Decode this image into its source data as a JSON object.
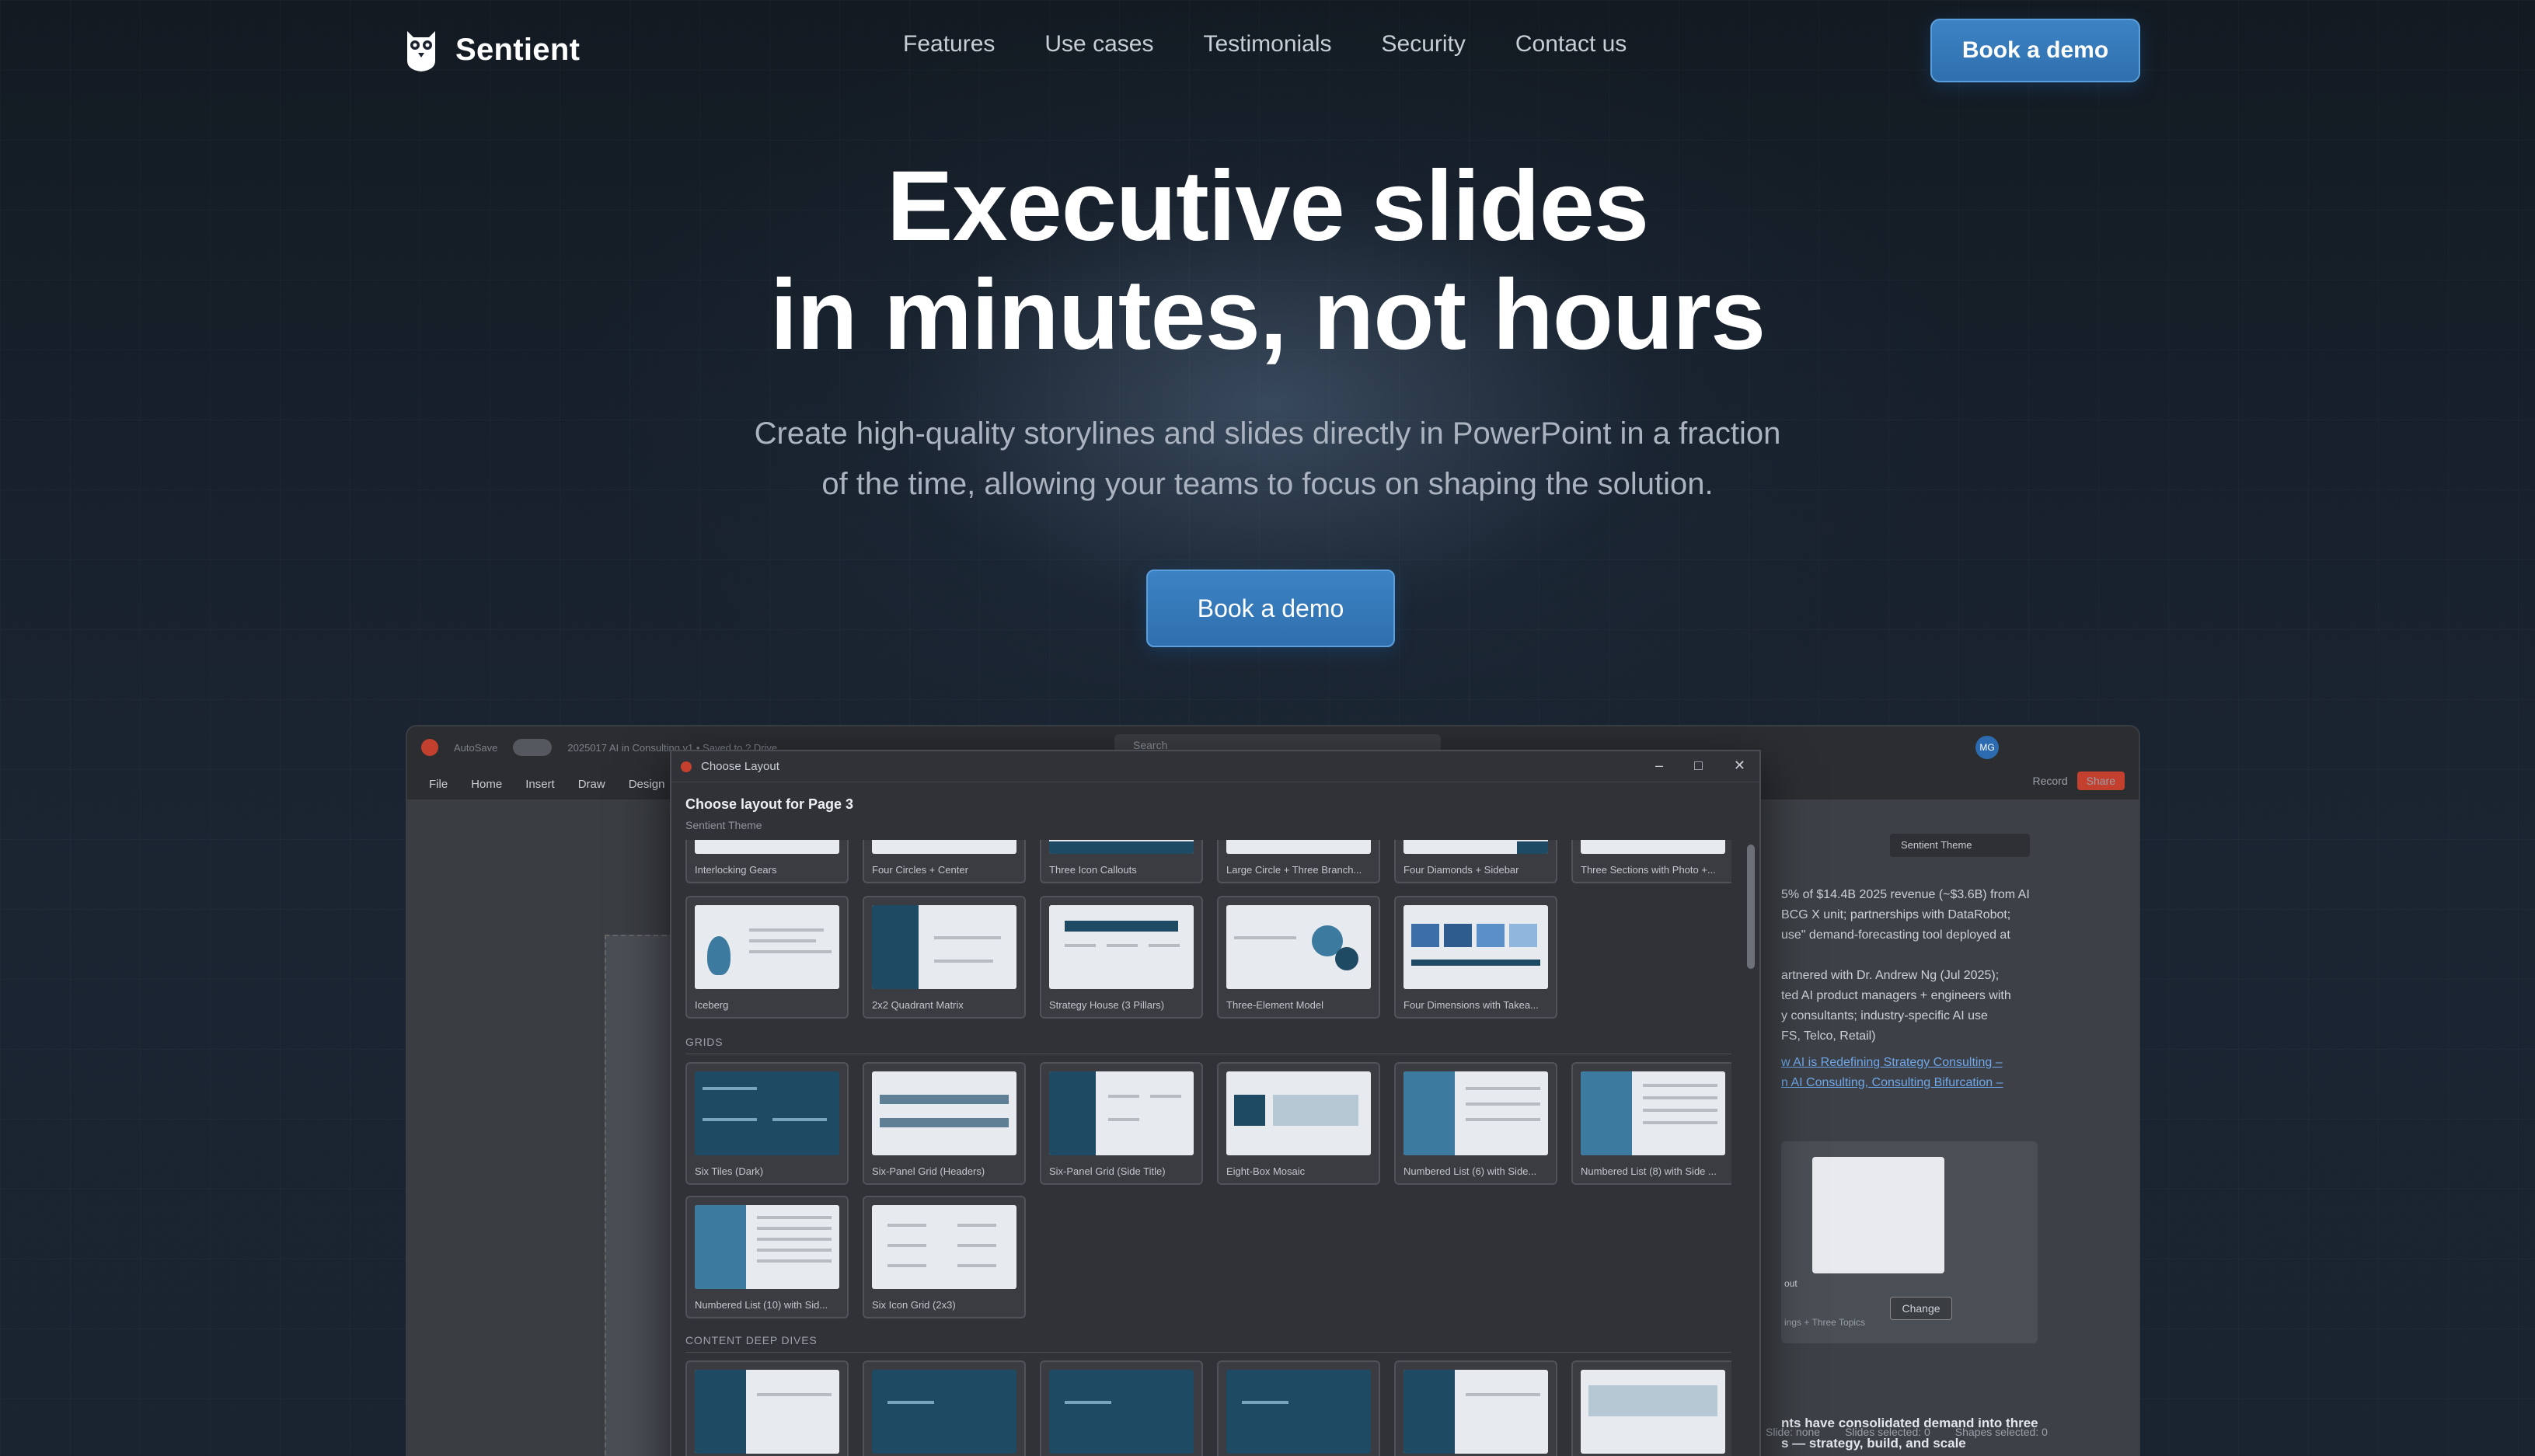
{
  "nav": {
    "brand": "Sentient",
    "links": [
      "Features",
      "Use cases",
      "Testimonials",
      "Security",
      "Contact us"
    ],
    "cta": "Book a demo"
  },
  "hero": {
    "title_line1": "Executive slides",
    "title_line2": "in minutes, not hours",
    "sub_line1": "Create high-quality storylines and slides directly in PowerPoint in a fraction",
    "sub_line2": "of the time, allowing your teams to focus on shaping the solution.",
    "cta": "Book a demo"
  },
  "app": {
    "autosave": "AutoSave",
    "autosave_state": "Off",
    "doc_title": "2025017 AI in Consulting v1 • Saved to ? Drive",
    "search_placeholder": "Search",
    "user_initials": "MG",
    "menu": [
      "File",
      "Home",
      "Insert",
      "Draw",
      "Design"
    ],
    "record": "Record",
    "share": "Share",
    "side": {
      "theme": "Sentient Theme",
      "text_1": "5% of $14.4B 2025 revenue (~$3.6B) from AI",
      "text_2": "BCG X unit; partnerships with DataRobot;",
      "text_3": "use\" demand-forecasting tool deployed at",
      "text_4": "artnered with Dr. Andrew Ng (Jul 2025);",
      "text_5": "ted AI product managers + engineers with",
      "text_6": "y consultants; industry-specific AI use",
      "text_7": "FS, Telco, Retail)",
      "link_1": "w AI is Redefining Strategy Consulting –",
      "link_2": "n AI Consulting, Consulting Bifurcation –",
      "card_caption_1": "out",
      "card_caption_2": "ings + Three Topics",
      "change": "Change",
      "bottom_1": "nts have consolidated demand into three",
      "bottom_2": "s — strategy, build, and scale"
    },
    "status": [
      "Slide: none",
      "Slides selected: 0",
      "Shapes selected: 0"
    ],
    "dialog": {
      "window_title": "Choose Layout",
      "heading": "Choose layout for Page 3",
      "subheading": "Sentient Theme",
      "row_top": [
        "Interlocking Gears",
        "Four Circles + Center",
        "Three Icon Callouts",
        "Large Circle + Three Branch...",
        "Four Diamonds + Sidebar",
        "Three Sections with Photo +..."
      ],
      "row_second": [
        "Iceberg",
        "2x2 Quadrant Matrix",
        "Strategy House (3 Pillars)",
        "Three-Element Model",
        "Four Dimensions with Takea..."
      ],
      "section_grids": "GRIDS",
      "grids_row1": [
        "Six Tiles (Dark)",
        "Six-Panel Grid (Headers)",
        "Six-Panel Grid (Side Title)",
        "Eight-Box Mosaic",
        "Numbered List (6) with Side...",
        "Numbered List (8) with Side ..."
      ],
      "grids_row2": [
        "Numbered List (10) with Sid...",
        "Six Icon Grid (2x3)"
      ],
      "section_deep": "CONTENT DEEP DIVES"
    }
  },
  "colors": {
    "accent": "#3c83c4",
    "ppt_red": "#c4402e",
    "slide_dark": "#1f4a63"
  }
}
